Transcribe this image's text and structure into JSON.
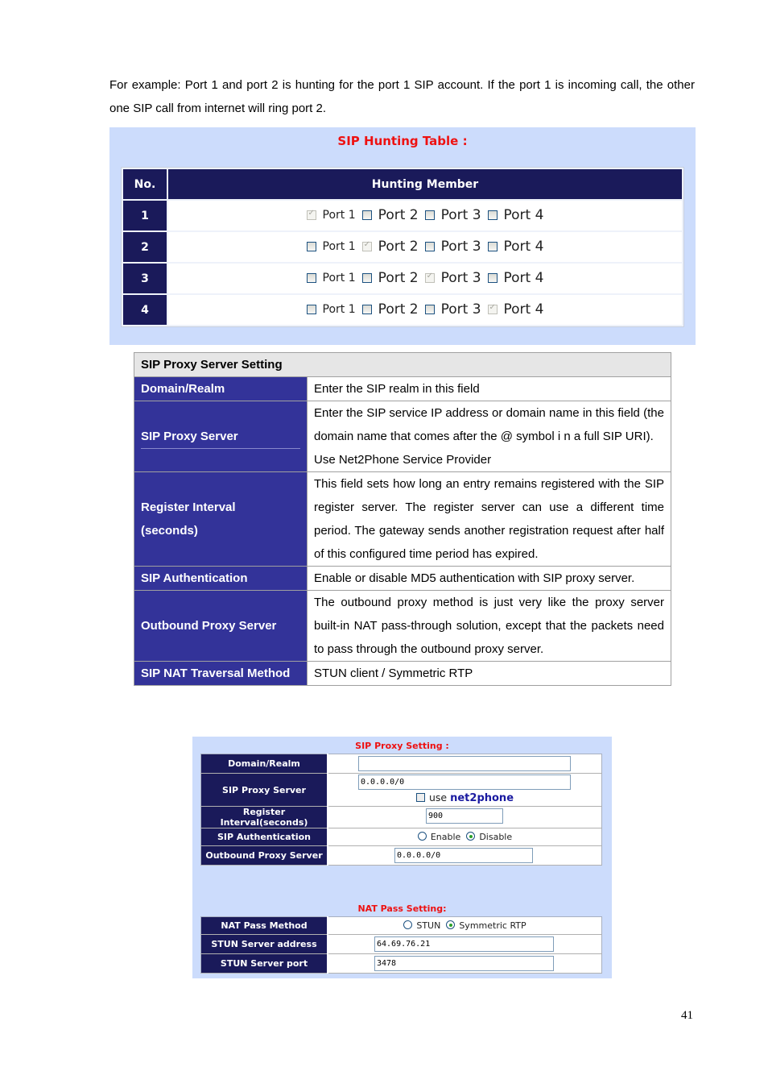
{
  "intro_text": "For example: Port 1 and port 2 is hunting for the port 1 SIP account. If the port 1 is incoming call, the other one SIP call from internet will ring port 2.",
  "hunting_table": {
    "title": "SIP Hunting Table :",
    "headers": {
      "no": "No.",
      "member": "Hunting Member"
    },
    "rows": [
      {
        "no": "1",
        "ports": [
          {
            "label": "Port 1",
            "checked": true
          },
          {
            "label": "Port 2",
            "checked": false
          },
          {
            "label": "Port 3",
            "checked": false
          },
          {
            "label": "Port 4",
            "checked": false
          }
        ]
      },
      {
        "no": "2",
        "ports": [
          {
            "label": "Port 1",
            "checked": false
          },
          {
            "label": "Port 2",
            "checked": true
          },
          {
            "label": "Port 3",
            "checked": false
          },
          {
            "label": "Port 4",
            "checked": false
          }
        ]
      },
      {
        "no": "3",
        "ports": [
          {
            "label": "Port 1",
            "checked": false
          },
          {
            "label": "Port 2",
            "checked": false
          },
          {
            "label": "Port 3",
            "checked": true
          },
          {
            "label": "Port 4",
            "checked": false
          }
        ]
      },
      {
        "no": "4",
        "ports": [
          {
            "label": "Port 1",
            "checked": false
          },
          {
            "label": "Port 2",
            "checked": false
          },
          {
            "label": "Port 3",
            "checked": false
          },
          {
            "label": "Port 4",
            "checked": true
          }
        ]
      }
    ]
  },
  "description_table": {
    "heading": "SIP Proxy Server Setting",
    "rows": [
      {
        "label": "Domain/Realm",
        "lines": [
          "Enter the SIP realm in this field"
        ]
      },
      {
        "label": "SIP Proxy Server",
        "lines": [
          "Enter the SIP service IP address or domain name in this field (the domain name that comes after the @ symbol i n a full SIP URI).",
          "Use Net2Phone Service Provider"
        ]
      },
      {
        "label": "Register Interval (seconds)",
        "lines": [
          "This field sets how long an entry remains registered with the SIP register server. The register server can use a different time period. The gateway sends another registration request after half of this configured time period has expired."
        ]
      },
      {
        "label": "SIP Authentication",
        "lines": [
          "Enable or disable MD5 authentication with SIP proxy server."
        ]
      },
      {
        "label": "Outbound Proxy Server",
        "lines": [
          "The outbound proxy method is just very like the proxy server built-in NAT pass-through solution, except that the packets need to pass through the outbound proxy server."
        ]
      },
      {
        "label": "SIP NAT Traversal Method",
        "lines": [
          "STUN client / Symmetric RTP"
        ]
      }
    ]
  },
  "sip_proxy_setting": {
    "title": "SIP Proxy Setting :",
    "domain_label": "Domain/Realm",
    "domain_value": "",
    "proxy_label": "SIP Proxy Server",
    "proxy_value": "0.0.0.0/0",
    "use_label": "use",
    "net2phone_label": "net2phone",
    "use_net2phone_checked": false,
    "register_label": "Register Interval(seconds)",
    "register_value": "900",
    "auth_label": "SIP Authentication",
    "auth_options": [
      "Enable",
      "Disable"
    ],
    "auth_selected": "Disable",
    "outbound_label": "Outbound Proxy Server",
    "outbound_value": "0.0.0.0/0"
  },
  "nat_pass_setting": {
    "title": "NAT Pass Setting:",
    "method_label": "NAT Pass Method",
    "method_options": [
      "STUN",
      "Symmetric RTP"
    ],
    "method_selected": "Symmetric RTP",
    "stun_address_label": "STUN Server address",
    "stun_address_value": "64.69.76.21",
    "stun_port_label": "STUN Server port",
    "stun_port_value": "3478"
  },
  "page_number": "41"
}
